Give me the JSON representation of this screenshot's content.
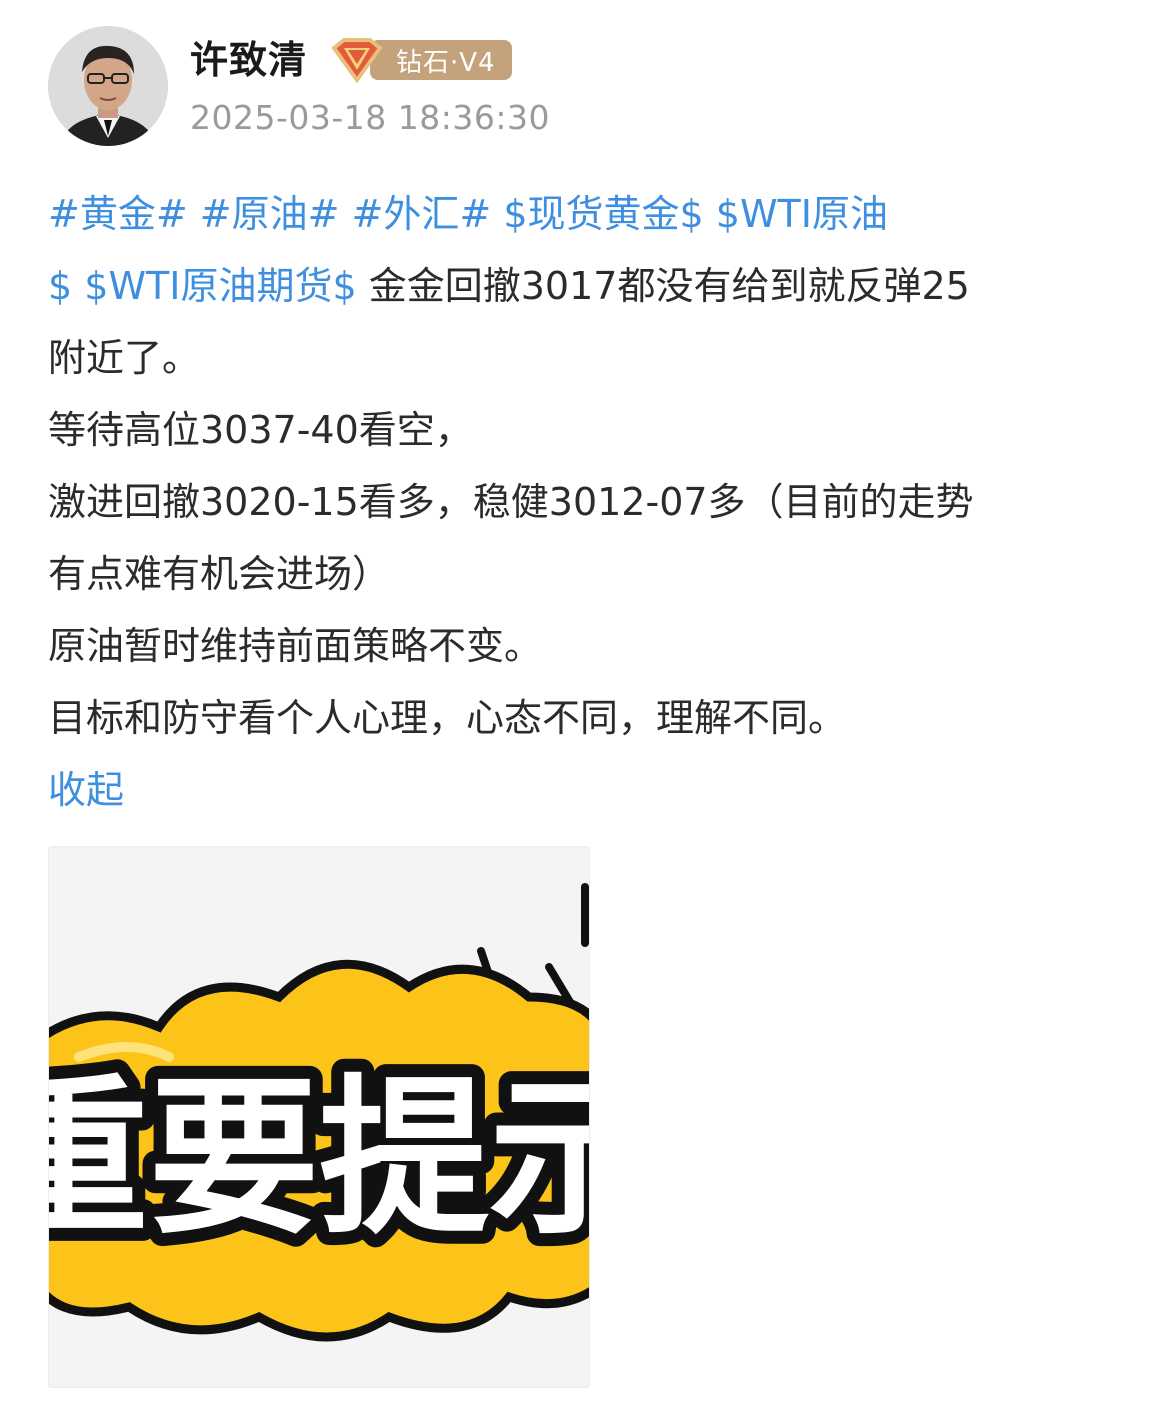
{
  "user": {
    "name": "许致清",
    "badge_label": "钻石·V4",
    "timestamp": "2025-03-18 18:36:30"
  },
  "post": {
    "lines": [
      {
        "tags": [
          "#黄金#",
          "#原油#",
          "#外汇#",
          "$现货黄金$",
          "$WTI原油"
        ],
        "text": ""
      },
      {
        "tags": [
          "$",
          "$WTI原油期货$"
        ],
        "text": "金金回撤3017都没有给到就反弹25"
      },
      {
        "tags": [],
        "text": "附近了。"
      },
      {
        "tags": [],
        "text": "等待高位3037-40看空，"
      },
      {
        "tags": [],
        "text": "激进回撤3020-15看多，稳健3012-07多（目前的走势"
      },
      {
        "tags": [],
        "text": "有点难有机会进场）"
      },
      {
        "tags": [],
        "text": "原油暂时维持前面策略不变。"
      },
      {
        "tags": [],
        "text": "目标和防守看个人心理，心态不同，理解不同。"
      }
    ],
    "collapse_label": "收起"
  },
  "image": {
    "text": "重要提示",
    "colors": {
      "bubble": "#fcc419",
      "bubble_outline": "#111111",
      "text_fill": "#ffffff",
      "background": "#f4f4f4"
    }
  },
  "colors": {
    "link": "#3f8fe0",
    "badge": "#c4a27c",
    "timestamp": "#9a9a9a"
  }
}
